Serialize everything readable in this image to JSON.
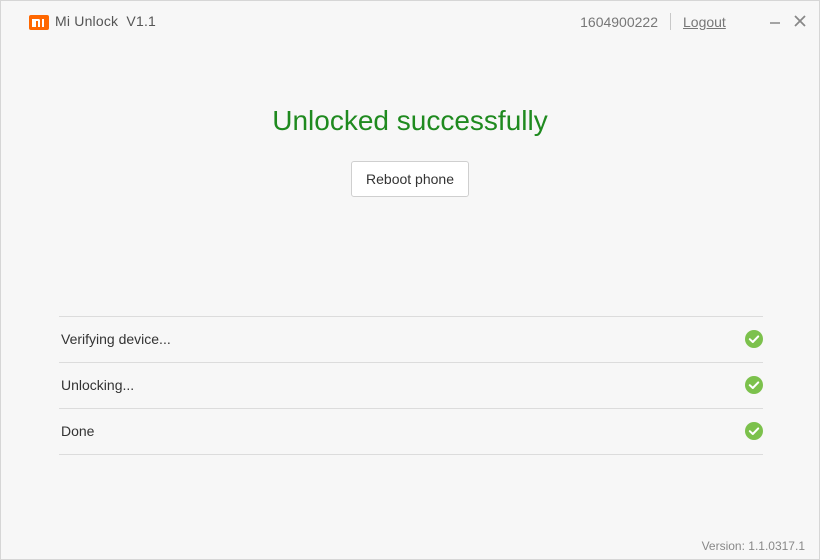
{
  "app": {
    "title": "Mi Unlock  V1.1",
    "logo_icon": "mi-logo-icon",
    "brand_color": "#ff6700"
  },
  "header": {
    "account_id": "1604900222",
    "logout_label": "Logout",
    "minimize_icon": "minimize-icon",
    "close_icon": "close-icon"
  },
  "main": {
    "headline": "Unlocked successfully",
    "headline_color": "#1f8a1f",
    "reboot_label": "Reboot phone"
  },
  "steps": [
    {
      "label": "Verifying device...",
      "status": "done",
      "icon": "check-circle-icon"
    },
    {
      "label": "Unlocking...",
      "status": "done",
      "icon": "check-circle-icon"
    },
    {
      "label": "Done",
      "status": "done",
      "icon": "check-circle-icon"
    }
  ],
  "status_color": "#7cc14c",
  "footer": {
    "version": "Version: 1.1.0317.1"
  }
}
